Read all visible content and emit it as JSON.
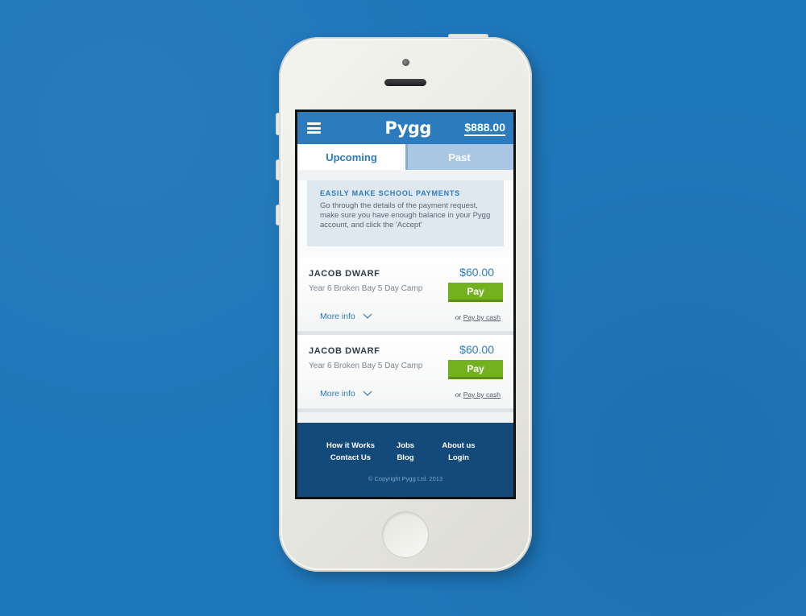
{
  "header": {
    "logo": "Pygg",
    "balance": "$888.00"
  },
  "tabs": [
    {
      "label": "Upcoming",
      "active": true
    },
    {
      "label": "Past",
      "active": false
    }
  ],
  "info": {
    "title": "EASILY MAKE SCHOOL PAYMENTS",
    "text": "Go through the details of the payment request, make sure you have enough balance in your Pygg account, and click the 'Accept'"
  },
  "payments": [
    {
      "name": "JACOB DWARF",
      "description": "Year 6 Broken Bay 5 Day Camp",
      "amount": "$60.00",
      "pay_label": "Pay",
      "more_info": "More info",
      "cash_prefix": "or",
      "cash_link": "Pay by cash"
    },
    {
      "name": "JACOB DWARF",
      "description": "Year 6 Broken Bay 5 Day Camp",
      "amount": "$60.00",
      "pay_label": "Pay",
      "more_info": "More info",
      "cash_prefix": "or",
      "cash_link": "Pay by cash"
    }
  ],
  "footer": {
    "links": [
      [
        "How it Works",
        "Contact Us"
      ],
      [
        "Jobs",
        "Blog"
      ],
      [
        "About us",
        "Login"
      ]
    ],
    "copyright": "© Copyright Pygg Ltd. 2013"
  },
  "icons": {
    "menu": "hamburger-menu-icon",
    "chevron": "chevron-down-icon"
  },
  "colors": {
    "background": "#1f77bb",
    "brand_blue": "#2b7bbd",
    "pay_green": "#73b11f",
    "footer": "#134a79"
  }
}
